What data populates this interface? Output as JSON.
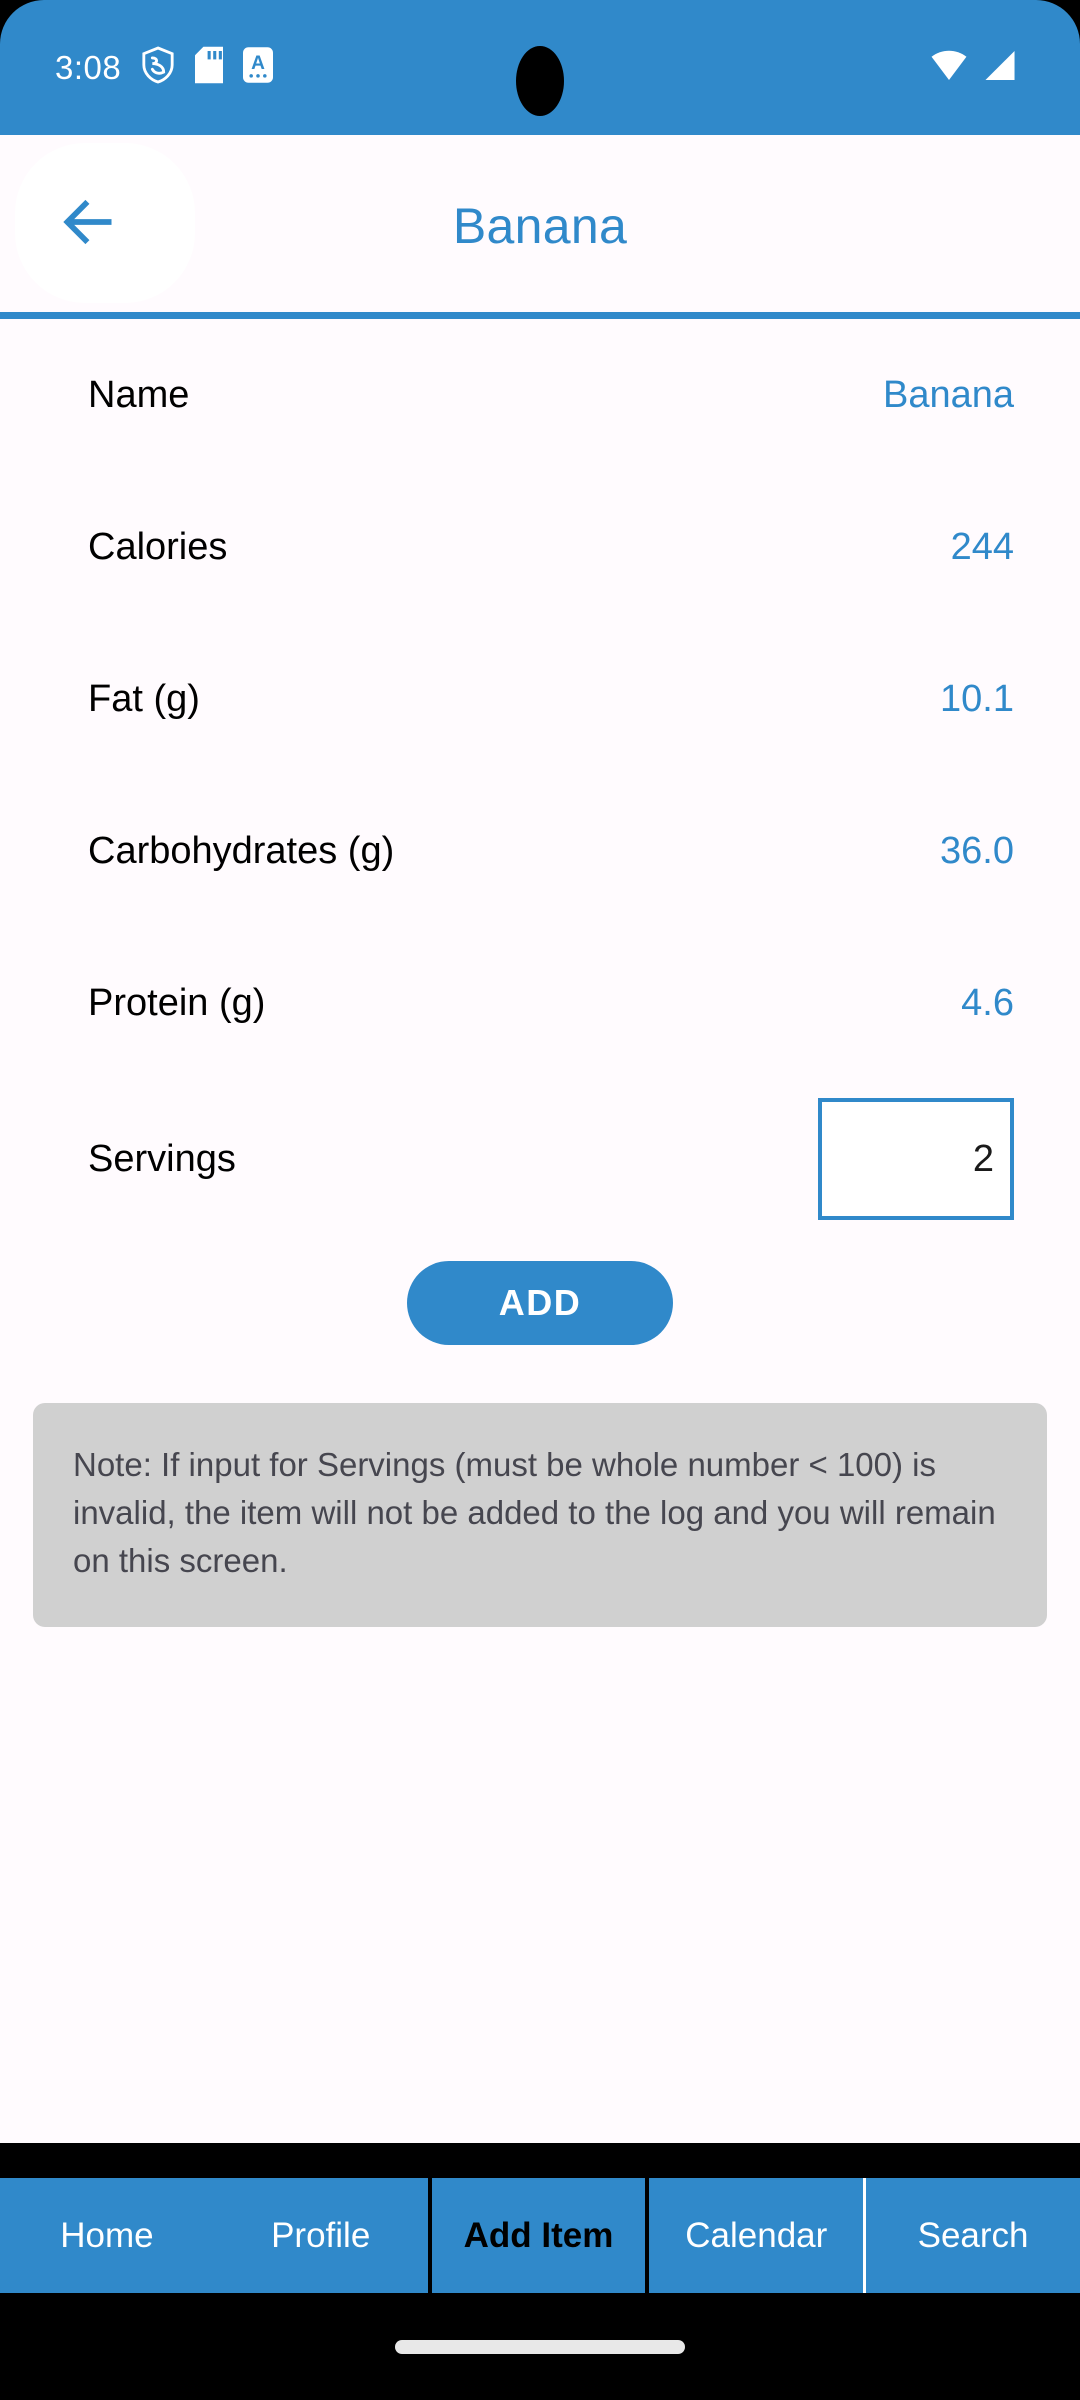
{
  "status_bar": {
    "time": "3:08",
    "icons_left": [
      "shield-icon",
      "sd-card-icon",
      "letter-a-icon"
    ],
    "icons_right": [
      "wifi-icon",
      "cellular-signal-icon"
    ]
  },
  "app_bar": {
    "back_icon": "arrow-left-icon",
    "title": "Banana"
  },
  "details": {
    "rows": [
      {
        "label": "Name",
        "value": "Banana"
      },
      {
        "label": "Calories",
        "value": "244"
      },
      {
        "label": "Fat (g)",
        "value": "10.1"
      },
      {
        "label": "Carbohydrates (g)",
        "value": "36.0"
      },
      {
        "label": "Protein (g)",
        "value": "4.6"
      }
    ],
    "servings": {
      "label": "Servings",
      "value": "2",
      "placeholder": ""
    }
  },
  "actions": {
    "add_label": "ADD"
  },
  "note": {
    "text": "Note: If input for Servings (must be whole number < 100) is invalid, the item will not be added to the log and you will remain on this screen."
  },
  "bottom_nav": {
    "tabs": [
      {
        "label": "Home",
        "active": false
      },
      {
        "label": "Profile",
        "active": false
      },
      {
        "label": "Add Item",
        "active": true
      },
      {
        "label": "Calendar",
        "active": false
      },
      {
        "label": "Search",
        "active": false
      }
    ]
  },
  "colors": {
    "primary": "#3089ca",
    "surface": "#fffbfe",
    "note_bg": "#d0d0d0",
    "note_text": "#46464f",
    "nav_active_text": "#000000"
  }
}
